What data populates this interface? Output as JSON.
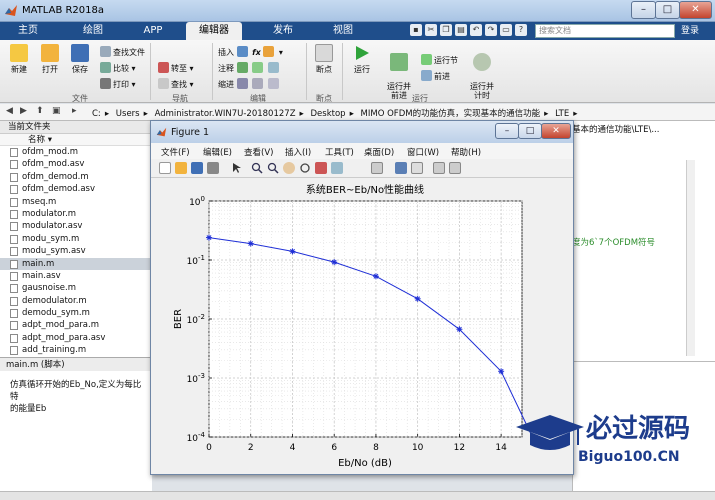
{
  "window": {
    "title": "MATLAB R2018a",
    "min": "–",
    "max": "□",
    "close": "✕"
  },
  "tabs": [
    {
      "label": "主页",
      "active": false
    },
    {
      "label": "绘图",
      "active": false
    },
    {
      "label": "APP",
      "active": false
    },
    {
      "label": "编辑器",
      "active": true
    },
    {
      "label": "发布",
      "active": false
    },
    {
      "label": "视图",
      "active": false
    }
  ],
  "search": {
    "placeholder": "搜索文档"
  },
  "login": "登录",
  "ribbon": {
    "new": "新建",
    "open": "打开",
    "save": "保存",
    "find_files": "查找文件",
    "compare": "比较",
    "print": "打印",
    "insert": "插入",
    "comment": "注释",
    "indent": "缩进",
    "goto": "转至",
    "find": "查找",
    "breakpoints": "断点",
    "run": "运行",
    "run_advance": "运行并\n前进",
    "run_section": "运行节",
    "advance": "前进",
    "run_time": "运行并\n计时",
    "group_file": "文件",
    "group_nav": "导航",
    "group_edit": "编辑",
    "group_bp": "断点",
    "group_run": "运行"
  },
  "breadcrumbs": [
    "C:",
    "Users",
    "Administrator.WIN7U-20180127Z",
    "Desktop",
    "MIMO OFDM的功能仿真，实现基本的通信功能",
    "LTE"
  ],
  "folder": {
    "title": "当前文件夹",
    "header": "名称",
    "files": [
      "ofdm_mod.m",
      "ofdm_mod.asv",
      "ofdm_demod.m",
      "ofdm_demod.asv",
      "mseq.m",
      "modulator.m",
      "modulator.asv",
      "modu_sym.m",
      "modu_sym.asv",
      "main.m",
      "main.asv",
      "gausnoise.m",
      "demodulator.m",
      "demodu_sym.m",
      "adpt_mod_para.m",
      "adpt_mod_para.asv",
      "add_training.m"
    ],
    "selected": "main.m"
  },
  "details": {
    "title": "main.m  (脚本)",
    "text_line1": "仿真循环开始的Eb_No,定义为每比特",
    "text_line2": "的能量Eb"
  },
  "editor": {
    "path_fragment": "基本的通信功能\\LTE\\...",
    "comment_fragment": "度为6`7个OFDM符号"
  },
  "figure": {
    "title": "Figure 1",
    "menu": [
      "文件(F)",
      "编辑(E)",
      "查看(V)",
      "插入(I)",
      "工具(T)",
      "桌面(D)",
      "窗口(W)",
      "帮助(H)"
    ]
  },
  "chart_data": {
    "type": "line",
    "title": "系统BER~Eb/No性能曲线",
    "xlabel": "Eb/No (dB)",
    "ylabel": "BER",
    "xlim": [
      0,
      15
    ],
    "ylim": [
      0.0001,
      1
    ],
    "yscale": "log",
    "grid": true,
    "xticks": [
      "0",
      "2",
      "4",
      "6",
      "8",
      "10",
      "12",
      "14"
    ],
    "yticks": [
      "10^0",
      "10^-1",
      "10^-2",
      "10^-3",
      "10^-4"
    ],
    "series": [
      {
        "color": "#1f2fd6",
        "marker": "star",
        "x": [
          0,
          2,
          4,
          6,
          8,
          10,
          12,
          14,
          15.5
        ],
        "y": [
          0.24,
          0.19,
          0.14,
          0.092,
          0.053,
          0.022,
          0.0067,
          0.0013,
          0.0001
        ]
      }
    ]
  },
  "watermark": {
    "text": "必过源码",
    "url": "Biguo100.CN"
  }
}
